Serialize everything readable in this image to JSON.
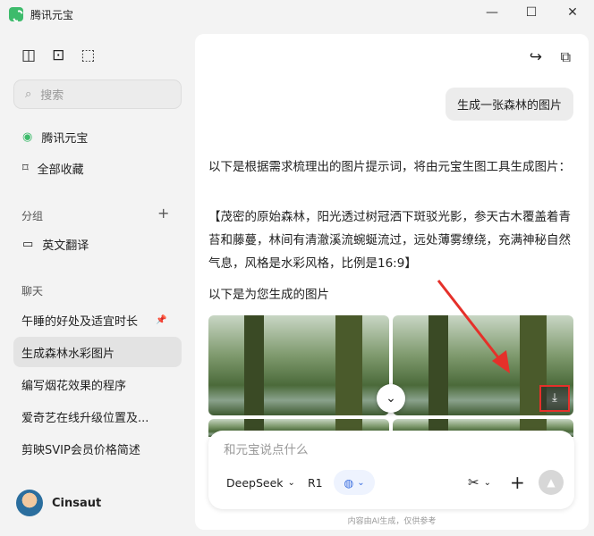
{
  "window": {
    "title": "腾讯元宝",
    "min": "—",
    "max": "☐",
    "close": "✕"
  },
  "sidebar": {
    "search_placeholder": "搜索",
    "nav": [
      {
        "label": "腾讯元宝"
      },
      {
        "label": "全部收藏"
      }
    ],
    "groups_title": "分组",
    "groups_add": "+",
    "groups": [
      {
        "label": "英文翻译"
      }
    ],
    "chats_title": "聊天",
    "chats": [
      {
        "label": "午睡的好处及适宜时长",
        "pinned": true
      },
      {
        "label": "生成森林水彩图片",
        "active": true
      },
      {
        "label": "编写烟花效果的程序"
      },
      {
        "label": "爱奇艺在线升级位置及..."
      },
      {
        "label": "剪映SVIP会员价格简述"
      }
    ],
    "user": {
      "name": "Cinsaut"
    }
  },
  "main": {
    "user_message": "生成一张森林的图片",
    "reply_intro": "以下是根据需求梳理出的图片提示词，将由元宝生图工具生成图片：",
    "prompt": "【茂密的原始森林，阳光透过树冠洒下斑驳光影，参天古木覆盖着青苔和藤蔓，林间有清澈溪流蜿蜒流过，远处薄雾缭绕，充满神秘自然气息，风格是水彩风格，比例是16:9】",
    "images_intro": "以下是为您生成的图片",
    "input": {
      "placeholder": "和元宝说点什么",
      "model": "DeepSeek",
      "mode": "R1"
    },
    "footer": "内容由AI生成，仅供参考"
  },
  "colors": {
    "accent": "#3dbb6b",
    "highlight": "#e5302a"
  }
}
